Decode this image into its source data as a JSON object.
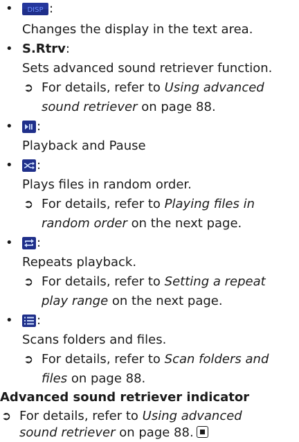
{
  "items": [
    {
      "icon": "disp-button-icon",
      "icon_label": "DISP",
      "desc": "Changes the display in the text area."
    },
    {
      "label": "S.Rtrv",
      "desc": "Sets advanced sound retriever function.",
      "ref_prefix": "For details, refer to ",
      "ref_italic_1": "Using advanced",
      "ref_italic_2": "sound retriever",
      "ref_suffix": " on page 88."
    },
    {
      "icon": "play-pause-button-icon",
      "desc": "Playback and Pause"
    },
    {
      "icon": "random-button-icon",
      "desc": "Plays files in random order.",
      "ref_prefix": "For details, refer to ",
      "ref_italic_1": "Playing files in",
      "ref_italic_2": "random order",
      "ref_suffix": " on the next page."
    },
    {
      "icon": "repeat-button-icon",
      "desc": "Repeats playback.",
      "ref_prefix": "For details, refer to ",
      "ref_italic_1": "Setting a repeat",
      "ref_italic_2": "play range",
      "ref_suffix": " on the next page."
    },
    {
      "icon": "scan-list-button-icon",
      "desc": "Scans folders and files.",
      "ref_prefix": "For details, refer to ",
      "ref_italic_1": "Scan folders and",
      "ref_italic_2": "files",
      "ref_suffix": " on page 88."
    }
  ],
  "indicator_heading": "Advanced sound retriever indicator",
  "indicator_ref": {
    "prefix": "For details, refer to ",
    "italic_1": "Using advanced",
    "italic_2": "sound retriever",
    "suffix": " on page 88."
  },
  "colors": {
    "button_bg": "#1f2f8a",
    "button_text": "#6f8fff",
    "icon_fg": "#cfe0ff"
  }
}
